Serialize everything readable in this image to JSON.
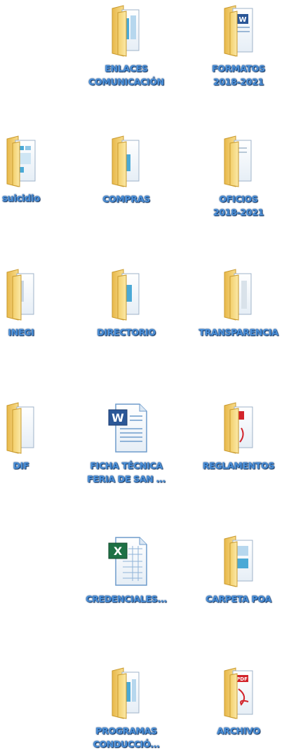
{
  "desktop": {
    "items": [
      {
        "label": "ENLACES\nCOMUNICACIÓN",
        "icon": "folder-icon"
      },
      {
        "label": "FORMATOS\n2018-2021",
        "icon": "folder-with-word-doc-icon"
      },
      {
        "label": "suicidio",
        "icon": "folder-icon"
      },
      {
        "label": "COMPRAS",
        "icon": "folder-icon"
      },
      {
        "label": "OFICIOS\n2018-2021",
        "icon": "folder-icon"
      },
      {
        "label": "INEGI",
        "icon": "folder-icon"
      },
      {
        "label": "DIRECTORIO",
        "icon": "folder-icon"
      },
      {
        "label": "TRANSPARENCIA",
        "icon": "folder-icon"
      },
      {
        "label": "DIF",
        "icon": "folder-icon"
      },
      {
        "label": "FICHA TÉCNICA\nFERIA DE SAN ...",
        "icon": "word-document-icon"
      },
      {
        "label": "REGLAMENTOS",
        "icon": "folder-with-pdf-icon"
      },
      {
        "label": "CREDENCIALES...",
        "icon": "excel-spreadsheet-icon"
      },
      {
        "label": "CARPETA POA",
        "icon": "folder-icon"
      },
      {
        "label": "PROGRAMAS\nCONDUCCIÓ...",
        "icon": "folder-icon"
      },
      {
        "label": "ARCHIVO",
        "icon": "pdf-file-icon"
      }
    ]
  },
  "colors": {
    "label_text": "#4a8fd8",
    "label_outline": "#1a4d8c",
    "folder_yellow": "#f5d67a",
    "word_blue": "#2b5797",
    "excel_green": "#1e7145",
    "pdf_red": "#d2232a"
  }
}
